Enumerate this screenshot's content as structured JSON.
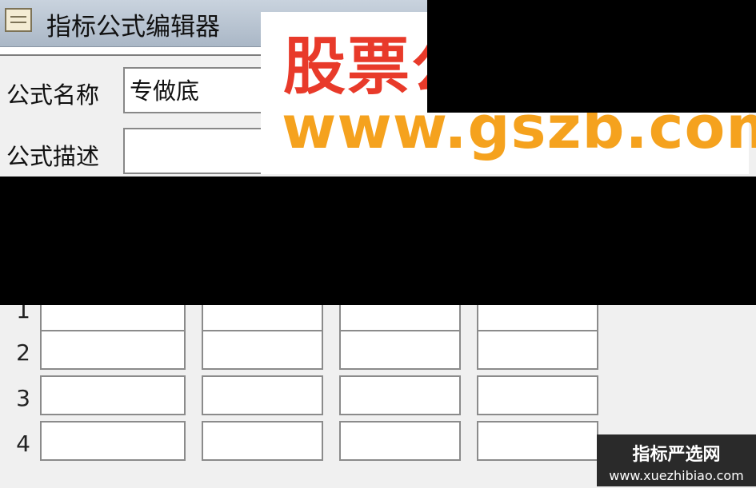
{
  "window": {
    "title": "指标公式编辑器"
  },
  "form": {
    "name_label": "公式名称",
    "name_value": "专做底",
    "desc_label": "公式描述",
    "desc_value": ""
  },
  "watermark": {
    "brand_cn": "股票公",
    "brand_url": "www.gszb.com",
    "corner_name": "指标严选网",
    "corner_url": "www.xuezhibiao.com"
  },
  "param_table": {
    "rows": [
      {
        "num": "1",
        "cells": [
          "",
          "",
          "",
          ""
        ]
      },
      {
        "num": "2",
        "cells": [
          "",
          "",
          "",
          ""
        ]
      },
      {
        "num": "3",
        "cells": [
          "",
          "",
          "",
          ""
        ]
      },
      {
        "num": "4",
        "cells": [
          "",
          "",
          "",
          ""
        ]
      }
    ]
  }
}
